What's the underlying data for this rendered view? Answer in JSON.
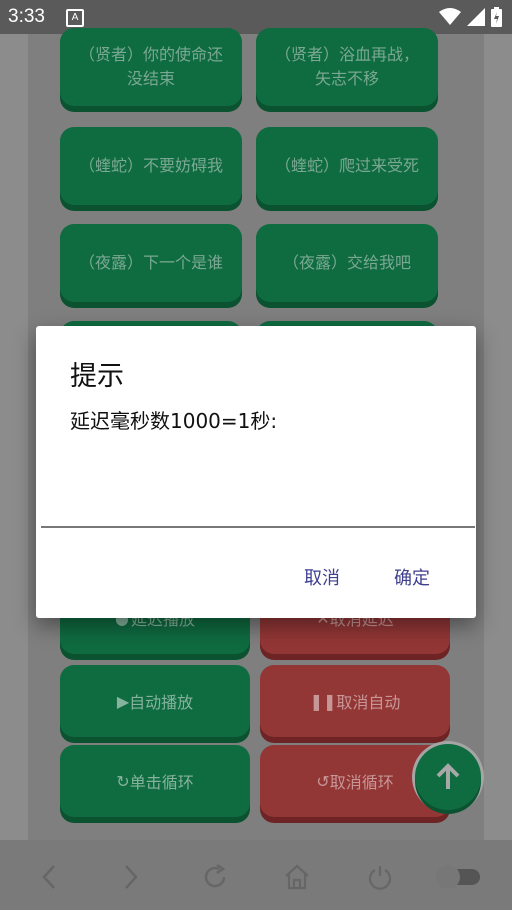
{
  "status": {
    "time": "3:33",
    "notif_glyph": "A"
  },
  "buttons": [
    {
      "label": "（贤者）你的使命还没结束"
    },
    {
      "label": "（贤者）浴血再战，矢志不移"
    },
    {
      "label": "（蝰蛇）不要妨碍我"
    },
    {
      "label": "（蝰蛇）爬过来受死"
    },
    {
      "label": "（夜露）下一个是谁"
    },
    {
      "label": "（夜露）交给我吧"
    }
  ],
  "controls": {
    "delay_play": "延迟播放",
    "cancel_delay": "取消延迟",
    "auto_play": "自动播放",
    "cancel_auto": "取消自动",
    "single_loop": "单击循环",
    "cancel_loop": "取消循环"
  },
  "dialog": {
    "title": "提示",
    "message": "延迟毫秒数1000=1秒:",
    "input_value": "",
    "cancel": "取消",
    "ok": "确定"
  },
  "colors": {
    "green": "#0f6b40",
    "red": "#933636",
    "accent_text": "#3f3f8f"
  }
}
